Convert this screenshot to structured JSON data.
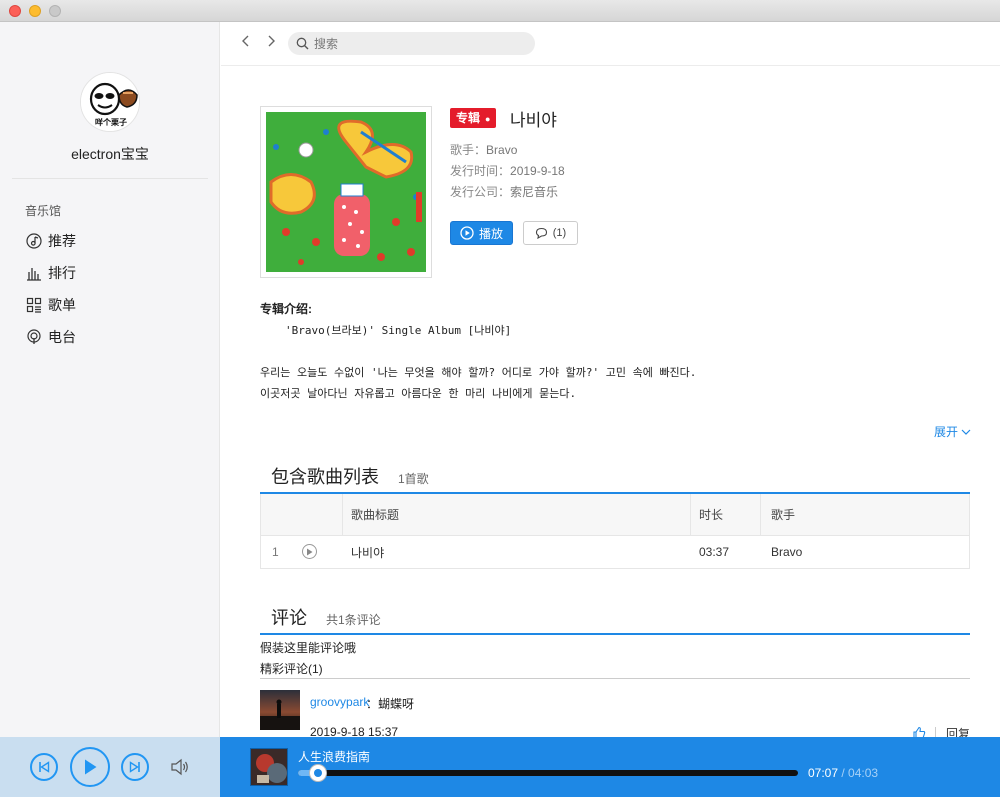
{
  "window": {
    "title": ""
  },
  "sidebar": {
    "username": "electron宝宝",
    "section_label": "音乐馆",
    "items": [
      {
        "label": "推荐",
        "icon": "music-note-icon"
      },
      {
        "label": "排行",
        "icon": "bar-chart-icon"
      },
      {
        "label": "歌单",
        "icon": "grid-icon"
      },
      {
        "label": "电台",
        "icon": "radio-icon"
      }
    ]
  },
  "topbar": {
    "search_placeholder": "搜索"
  },
  "album": {
    "tag": "专辑",
    "title": "나비야",
    "artist_label": "歌手：",
    "artist": "Bravo",
    "release_label": "发行时间：",
    "release_date": "2019-9-18",
    "company_label": "发行公司：",
    "company": "索尼音乐",
    "play_label": "播放",
    "comment_count": "(1)"
  },
  "intro": {
    "heading": "专辑介绍:",
    "line1": "'Bravo(브라보)' Single Album [나비야]",
    "desc1": "우리는 오늘도 수없이 '나는 무엇을 해야 할까? 어디로 가야 할까?' 고민 속에 빠진다.",
    "desc2": "이곳저곳 날아다닌 자유롭고 아름다운 한 마리 나비에게 묻는다.",
    "expand": "展开"
  },
  "songs": {
    "title": "包含歌曲列表",
    "count": "1首歌",
    "columns": {
      "title": "歌曲标题",
      "duration": "时长",
      "artist": "歌手"
    },
    "rows": [
      {
        "index": "1",
        "title": "나비야",
        "duration": "03:37",
        "artist": "Bravo"
      }
    ]
  },
  "comments": {
    "title": "评论",
    "count": "共1条评论",
    "placeholder_text": "假装这里能评论哦",
    "hot_heading": "精彩评论(1)",
    "items": [
      {
        "user": "groovypark",
        "sep": "：",
        "text": "蝴蝶呀",
        "time": "2019-9-18 15:37",
        "reply": "回复"
      }
    ]
  },
  "player": {
    "song_title": "人生浪费指南",
    "current_time": "07:07",
    "total_time": "04:03",
    "progress": 0.04,
    "accent": "#1e88e5"
  }
}
